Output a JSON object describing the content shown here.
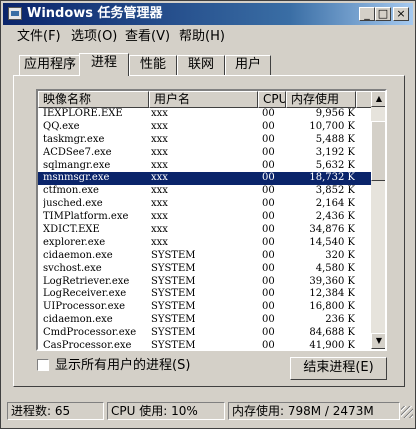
{
  "window": {
    "title": "Windows 任务管理器"
  },
  "title_buttons": {
    "minimize": "_",
    "maximize": "□",
    "close": "×"
  },
  "menu": [
    "文件(F)",
    "选项(O)",
    "查看(V)",
    "帮助(H)"
  ],
  "tabs": [
    "应用程序",
    "进程",
    "性能",
    "联网",
    "用户"
  ],
  "active_tab": "进程",
  "columns": {
    "name": "映像名称",
    "user": "用户名",
    "cpu": "CPU",
    "mem": "内存使用"
  },
  "processes": [
    {
      "name": "IEXPLORE.EXE",
      "user": "xxx",
      "cpu": "00",
      "mem": "9,956 K"
    },
    {
      "name": "QQ.exe",
      "user": "xxx",
      "cpu": "00",
      "mem": "10,700 K"
    },
    {
      "name": "taskmgr.exe",
      "user": "xxx",
      "cpu": "00",
      "mem": "5,488 K"
    },
    {
      "name": "ACDSee7.exe",
      "user": "xxx",
      "cpu": "00",
      "mem": "3,192 K"
    },
    {
      "name": "sqlmangr.exe",
      "user": "xxx",
      "cpu": "00",
      "mem": "5,632 K"
    },
    {
      "name": "msnmsgr.exe",
      "user": "xxx",
      "cpu": "00",
      "mem": "18,732 K"
    },
    {
      "name": "ctfmon.exe",
      "user": "xxx",
      "cpu": "00",
      "mem": "3,852 K"
    },
    {
      "name": "jusched.exe",
      "user": "xxx",
      "cpu": "00",
      "mem": "2,164 K"
    },
    {
      "name": "TIMPlatform.exe",
      "user": "xxx",
      "cpu": "00",
      "mem": "2,436 K"
    },
    {
      "name": "XDICT.EXE",
      "user": "xxx",
      "cpu": "00",
      "mem": "34,876 K"
    },
    {
      "name": "explorer.exe",
      "user": "xxx",
      "cpu": "00",
      "mem": "14,540 K"
    },
    {
      "name": "cidaemon.exe",
      "user": "SYSTEM",
      "cpu": "00",
      "mem": "320 K"
    },
    {
      "name": "svchost.exe",
      "user": "SYSTEM",
      "cpu": "00",
      "mem": "4,580 K"
    },
    {
      "name": "LogRetriever.exe",
      "user": "SYSTEM",
      "cpu": "00",
      "mem": "39,360 K"
    },
    {
      "name": "LogReceiver.exe",
      "user": "SYSTEM",
      "cpu": "00",
      "mem": "12,384 K"
    },
    {
      "name": "UIProcessor.exe",
      "user": "SYSTEM",
      "cpu": "00",
      "mem": "16,800 K"
    },
    {
      "name": "cidaemon.exe",
      "user": "SYSTEM",
      "cpu": "00",
      "mem": "236 K"
    },
    {
      "name": "CmdProcessor.exe",
      "user": "SYSTEM",
      "cpu": "00",
      "mem": "84,688 K"
    },
    {
      "name": "CasProcessor.exe",
      "user": "SYSTEM",
      "cpu": "00",
      "mem": "41,900 K"
    }
  ],
  "selected_process": "msnmsgr.exe",
  "show_all_users": {
    "label": "显示所有用户的进程(S)",
    "checked": false
  },
  "end_process_button": "结束进程(E)",
  "status": {
    "processes": "进程数: 65",
    "cpu": "CPU 使用: 10%",
    "memory": "内存使用: 798M / 2473M"
  },
  "colors": {
    "titlebar": "#0a246a",
    "selection": "#0a246a",
    "face": "#d4d0c8"
  }
}
